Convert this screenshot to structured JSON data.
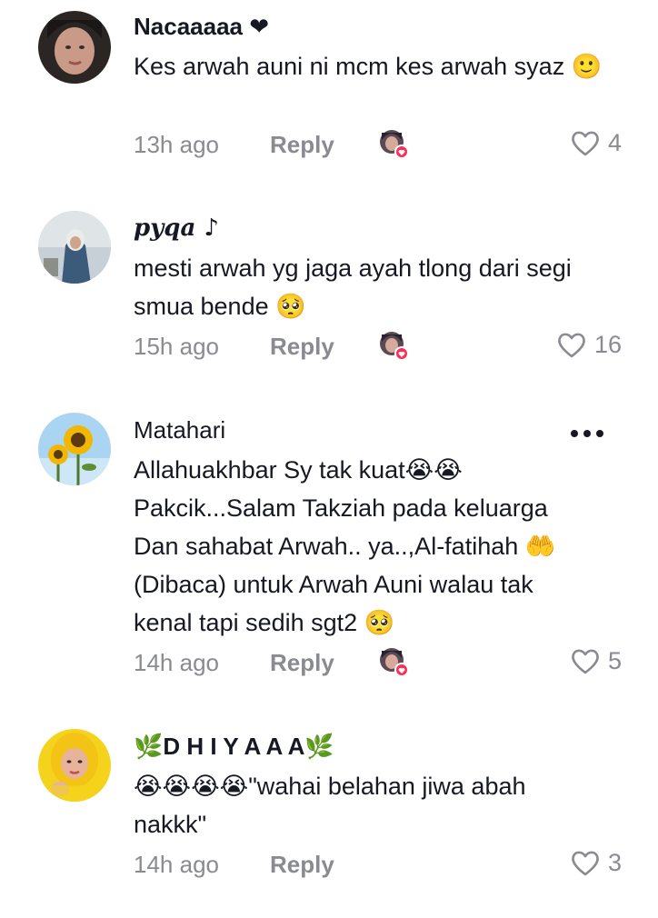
{
  "comments": [
    {
      "username": "Nacaaaaa ❤",
      "text": "Kes arwah auni ni mcm kes arwah syaz 🙂",
      "time": "13h ago",
      "reply": "Reply",
      "likes": "4",
      "liked_by_creator": true
    },
    {
      "username": "𝒑𝒚𝒒𝒂 ♪",
      "text": "mesti arwah yg jaga ayah tlong dari segi smua bende 🥺",
      "time": "15h ago",
      "reply": "Reply",
      "likes": "16",
      "liked_by_creator": true
    },
    {
      "username": "Matahari",
      "text": "Allahuakhbar Sy tak kuat😭😭 Pakcik...Salam Takziah pada keluarga Dan sahabat Arwah.. ya..,Al-fatihah 🤲 (Dibaca) untuk Arwah Auni walau tak kenal tapi sedih sgt2 🥺",
      "time": "14h ago",
      "reply": "Reply",
      "likes": "5",
      "liked_by_creator": true
    },
    {
      "username": "🌿D H I Y A A A🌿",
      "text": "😭😭😭😭\"wahai belahan jiwa abah nakkk\"",
      "time": "14h ago",
      "reply": "Reply",
      "likes": "3",
      "liked_by_creator": false
    }
  ],
  "icons": {
    "like": "heart-outline-icon",
    "more": "more-options-icon",
    "creator_like": "creator-liked-avatar-icon"
  },
  "colors": {
    "meta_gray": "#8a8b91",
    "text": "#161823",
    "like_badge": "#fe2c55"
  }
}
